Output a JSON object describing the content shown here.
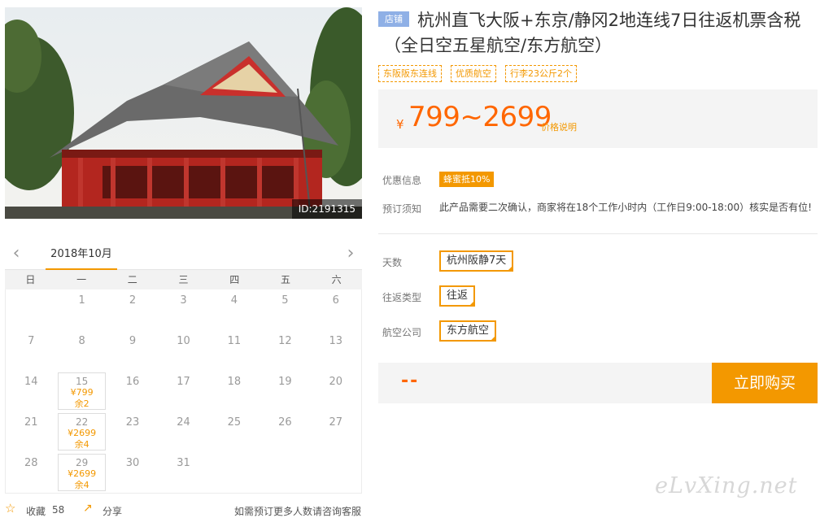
{
  "product": {
    "image_id": "ID:2191315",
    "shop_badge": "店铺",
    "title_line1": "杭州直飞大阪+东京/静冈2地连线7日往返机票含税",
    "title_line2": "（全日空五星航空/东方航空）",
    "tags": [
      "东阪阪东连线",
      "优质航空",
      "行李23公斤2个"
    ]
  },
  "price": {
    "currency": "¥",
    "range": "799~2699",
    "note": "价格说明"
  },
  "info": {
    "promo_label": "优惠信息",
    "promo_value": "蜂蜜抵10%",
    "notice_label": "预订须知",
    "notice_value": "此产品需要二次确认，商家将在18个工作小时内（工作日9:00-18:00）核实是否有位!"
  },
  "options": [
    {
      "label": "天数",
      "value": "杭州阪静7天"
    },
    {
      "label": "往返类型",
      "value": "往返"
    },
    {
      "label": "航空公司",
      "value": "东方航空"
    }
  ],
  "buy": {
    "total_placeholder": "--",
    "button_label": "立即购买"
  },
  "calendar": {
    "month": "2018年10月",
    "prev": "‹",
    "next": "›",
    "weekdays": [
      "日",
      "一",
      "二",
      "三",
      "四",
      "五",
      "六"
    ],
    "available": {
      "15": {
        "price": "¥799",
        "remain": "余2"
      },
      "22": {
        "price": "¥2699",
        "remain": "余4"
      },
      "29": {
        "price": "¥2699",
        "remain": "余4"
      }
    }
  },
  "footer": {
    "fav_label": "收藏",
    "fav_count": "58",
    "share_label": "分享",
    "more_text": "如需预订更多人数请咨询客服"
  },
  "watermark": "eLvXing.net"
}
